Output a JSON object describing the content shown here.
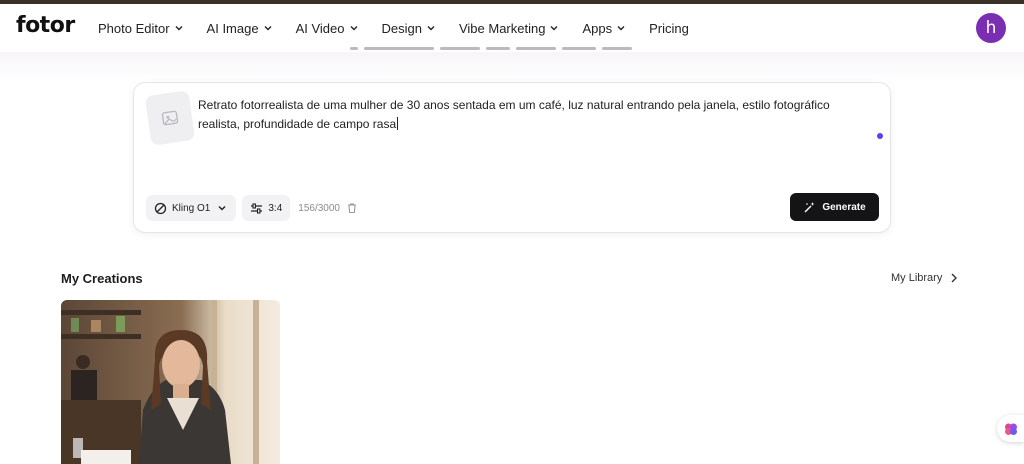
{
  "brand": {
    "logo_text": "fotor"
  },
  "nav": {
    "items": [
      {
        "label": "Photo Editor",
        "has_dropdown": true
      },
      {
        "label": "AI Image",
        "has_dropdown": true
      },
      {
        "label": "AI Video",
        "has_dropdown": true
      },
      {
        "label": "Design",
        "has_dropdown": true
      },
      {
        "label": "Vibe Marketing",
        "has_dropdown": true
      },
      {
        "label": "Apps",
        "has_dropdown": true
      },
      {
        "label": "Pricing",
        "has_dropdown": false
      }
    ],
    "avatar_initial": "h",
    "avatar_color": "#7a2fb3"
  },
  "prompt": {
    "text": "Retrato fotorrealista de uma mulher de 30 anos sentada em um café, luz natural entrando pela janela, estilo fotográfico realista, profundidade de campo rasa",
    "model_label": "Kling O1",
    "ratio_label": "3:4",
    "counter": "156/3000",
    "generate_label": "Generate"
  },
  "creations": {
    "title": "My Creations",
    "library_link": "My Library"
  },
  "colors": {
    "accent_dot": "#5a3ff0",
    "generate_bg": "#141416"
  }
}
